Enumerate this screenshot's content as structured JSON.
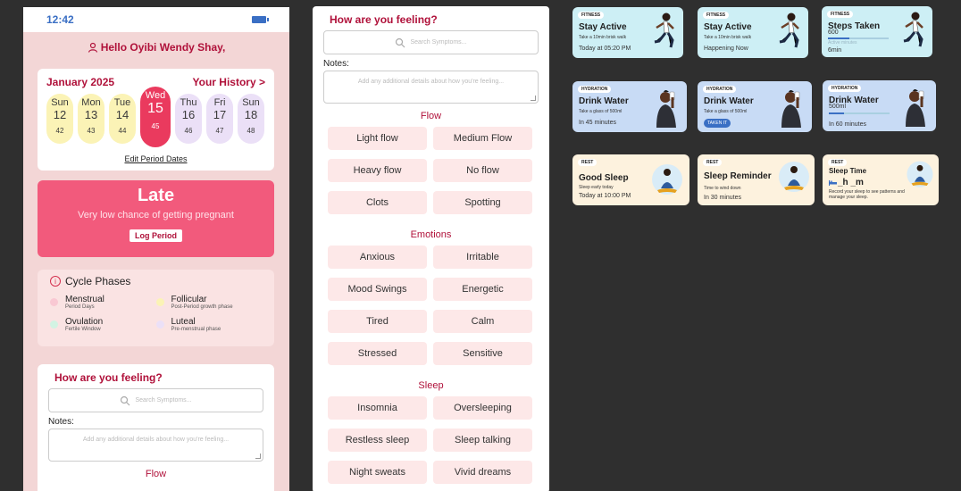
{
  "phone": {
    "time": "12:42",
    "greeting": "Hello Oyibi Wendy Shay,",
    "calendar": {
      "month": "January 2025",
      "history_link": "Your History >",
      "days": [
        {
          "name": "Sun",
          "date": "12",
          "cycle": "42",
          "state": "past"
        },
        {
          "name": "Mon",
          "date": "13",
          "cycle": "43",
          "state": "past"
        },
        {
          "name": "Tue",
          "date": "14",
          "cycle": "44",
          "state": "past"
        },
        {
          "name": "Wed",
          "date": "15",
          "cycle": "45",
          "state": "active"
        },
        {
          "name": "Thu",
          "date": "16",
          "cycle": "46",
          "state": "future"
        },
        {
          "name": "Fri",
          "date": "17",
          "cycle": "47",
          "state": "future"
        },
        {
          "name": "Sun",
          "date": "18",
          "cycle": "48",
          "state": "future"
        }
      ],
      "edit_link": "Edit Period Dates"
    },
    "status": {
      "title": "Late",
      "subtitle": "Very low chance of getting pregnant",
      "button": "Log Period"
    },
    "phases": {
      "title": "Cycle Phases",
      "items": [
        {
          "name": "Menstrual",
          "desc": "Period Days",
          "color": "#f9c8d3"
        },
        {
          "name": "Follicular",
          "desc": "Post-Period growth phase",
          "color": "#fbf3b6"
        },
        {
          "name": "Ovulation",
          "desc": "Fertile Window",
          "color": "#d2f3e3"
        },
        {
          "name": "Luteal",
          "desc": "Pre-menstrual phase",
          "color": "#ebe0f7"
        }
      ]
    }
  },
  "feeling": {
    "title": "How are you feeling?",
    "search_placeholder": "Search Symptoms...",
    "notes_label": "Notes:",
    "notes_placeholder": "Add any additional details about how you're feeling...",
    "flow_title": "Flow",
    "flow": [
      "Light flow",
      "Medium Flow",
      "Heavy flow",
      "No flow",
      "Clots",
      "Spotting"
    ],
    "emotions_title": "Emotions",
    "emotions": [
      "Anxious",
      "Irritable",
      "Mood Swings",
      "Energetic",
      "Tired",
      "Calm",
      "Stressed",
      "Sensitive"
    ],
    "sleep_title": "Sleep",
    "sleep": [
      "Insomnia",
      "Oversleeping",
      "Restless sleep",
      "Sleep talking",
      "Night sweats",
      "Vivid dreams"
    ]
  },
  "cards": {
    "fitness1": {
      "tag": "FITNESS",
      "title": "Stay Active",
      "sub": "Take a 10min brisk walk",
      "foot": "Today at 05:20 PM"
    },
    "fitness2": {
      "tag": "FITNESS",
      "title": "Stay Active",
      "sub": "Take a 10min brisk walk",
      "foot": "Happening Now"
    },
    "fitness3": {
      "tag": "FITNESS",
      "title": "Steps Taken",
      "value": "600",
      "progress_label": "Active minutes",
      "progress": 0.35,
      "foot": "6min"
    },
    "hydration1": {
      "tag": "HYDRATION",
      "title": "Drink Water",
      "sub": "Take a glass of 500ml",
      "foot": "In 45 minutes"
    },
    "hydration2": {
      "tag": "HYDRATION",
      "title": "Drink Water",
      "sub": "Take a glass of 500ml",
      "pill": "TAKEN IT"
    },
    "hydration3": {
      "tag": "HYDRATION",
      "title": "Drink Water",
      "value": "500ml",
      "progress": 0.25,
      "foot": "In 60 minutes"
    },
    "rest1": {
      "tag": "REST",
      "title": "Good Sleep",
      "sub": "Sleep early today",
      "foot": "Today at 10:00 PM"
    },
    "rest2": {
      "tag": "REST",
      "title": "Sleep Reminder",
      "sub": "Time to wind down",
      "foot": "In 30 minutes"
    },
    "rest3": {
      "tag": "REST",
      "title": "Sleep Time",
      "time": "_h _m",
      "sub": "Record your sleep to see patterns and manage your sleep."
    }
  }
}
